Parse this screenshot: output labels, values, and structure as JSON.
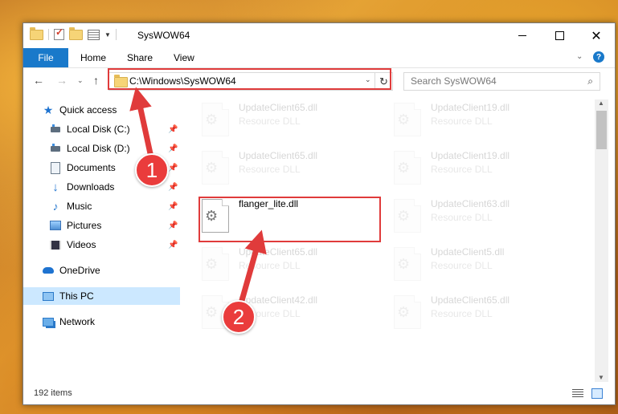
{
  "window": {
    "title": "SysWOW64",
    "minimize_label": "—",
    "close_label": "✕"
  },
  "ribbon": {
    "file": "File",
    "home": "Home",
    "share": "Share",
    "view": "View",
    "help": "?"
  },
  "nav": {
    "address": "C:\\Windows\\SysWOW64",
    "search_placeholder": "Search SysWOW64"
  },
  "sidebar": {
    "items": [
      {
        "label": "Quick access",
        "icon": "star-icon"
      },
      {
        "label": "Local Disk (C:)",
        "icon": "drive-icon"
      },
      {
        "label": "Local Disk (D:)",
        "icon": "drive-icon"
      },
      {
        "label": "Documents",
        "icon": "documents-icon"
      },
      {
        "label": "Downloads",
        "icon": "downloads-icon"
      },
      {
        "label": "Music",
        "icon": "music-icon"
      },
      {
        "label": "Pictures",
        "icon": "pictures-icon"
      },
      {
        "label": "Videos",
        "icon": "videos-icon"
      },
      {
        "label": "OneDrive",
        "icon": "onedrive-icon"
      },
      {
        "label": "This PC",
        "icon": "this-pc-icon"
      },
      {
        "label": "Network",
        "icon": "network-icon"
      }
    ]
  },
  "files": [
    {
      "name": "UpdateClient65.dll",
      "type": "Resource DLL"
    },
    {
      "name": "UpdateClient19.dll",
      "type": "Resource DLL"
    },
    {
      "name": "UpdateClient65.dll",
      "type": "Resource DLL"
    },
    {
      "name": "UpdateClient19.dll",
      "type": "Resource DLL"
    },
    {
      "name": "flanger_lite.dll",
      "type": ""
    },
    {
      "name": "UpdateClient63.dll",
      "type": "Resource DLL"
    },
    {
      "name": "UpdateClient65.dll",
      "type": "Resource DLL"
    },
    {
      "name": "UpdateClient5.dll",
      "type": "Resource DLL"
    },
    {
      "name": "UpdateClient42.dll",
      "type": "Resource DLL"
    },
    {
      "name": "UpdateClient65.dll",
      "type": "Resource DLL"
    }
  ],
  "status": {
    "item_count": "192 items"
  },
  "annotations": {
    "step1": "1",
    "step2": "2",
    "color": "#e03b3b"
  }
}
